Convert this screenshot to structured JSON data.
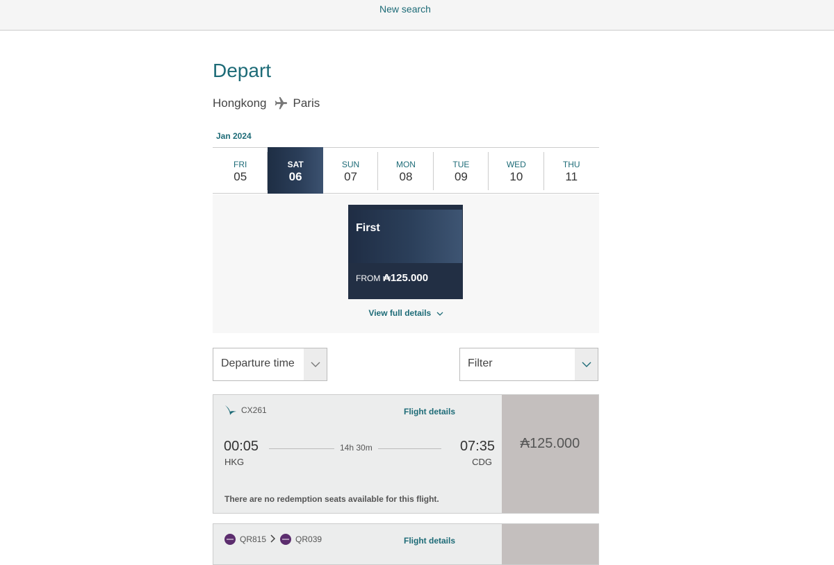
{
  "topbar": {
    "new_search": "New search"
  },
  "page": {
    "title": "Depart",
    "origin": "Hongkong",
    "destination": "Paris",
    "month": "Jan 2024"
  },
  "dates": [
    {
      "dow": "FRI",
      "day": "05",
      "active": false
    },
    {
      "dow": "SAT",
      "day": "06",
      "active": true
    },
    {
      "dow": "SUN",
      "day": "07",
      "active": false
    },
    {
      "dow": "MON",
      "day": "08",
      "active": false
    },
    {
      "dow": "TUE",
      "day": "09",
      "active": false
    },
    {
      "dow": "WED",
      "day": "10",
      "active": false
    },
    {
      "dow": "THU",
      "day": "11",
      "active": false
    }
  ],
  "cabin": {
    "name": "First",
    "from_label": "FROM",
    "price": "₳125.000"
  },
  "view_details": "View full details",
  "sort": {
    "label": "Departure time"
  },
  "filter": {
    "label": "Filter"
  },
  "flights": [
    {
      "airline_icon": "cathay-logo-icon",
      "number": "CX261",
      "details_label": "Flight details",
      "dep_time": "00:05",
      "dep_code": "HKG",
      "arr_time": "07:35",
      "arr_code": "CDG",
      "duration": "14h 30m",
      "price": "₳125.000",
      "notice": "There are no redemption seats available for this flight."
    },
    {
      "airline_icon": "qatar-logo-icon",
      "number_1": "QR815",
      "number_2": "QR039",
      "details_label": "Flight details"
    }
  ],
  "colors": {
    "accent": "#1d6b77",
    "navy": "#1e2e44",
    "price_bg": "#c4bfbe",
    "card_bg": "#eceded"
  }
}
